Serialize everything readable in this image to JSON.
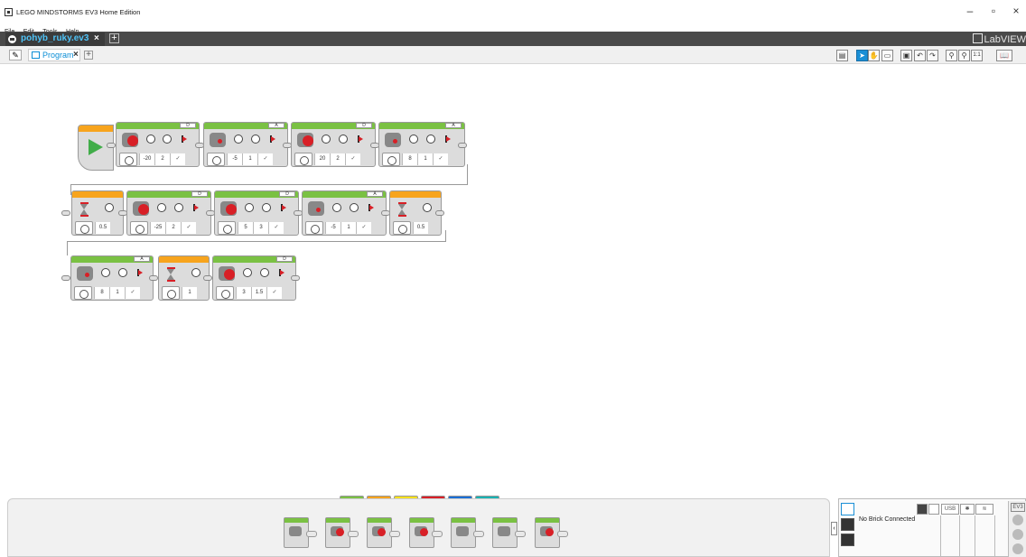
{
  "window": {
    "title": "LEGO MINDSTORMS EV3 Home Edition",
    "minimize": "–",
    "maximize": "▫",
    "close": "×"
  },
  "menu": [
    "File",
    "Edit",
    "Tools",
    "Help"
  ],
  "project": {
    "tab_label": "pohyb_ruky.ev3",
    "close": "×",
    "add": "+",
    "brand": "LabVIEW"
  },
  "program": {
    "tab_label": "Program",
    "close": "×",
    "add": "+"
  },
  "toolbar": {
    "icons": [
      "content-editor-icon",
      "select-icon",
      "pan-icon",
      "comment-icon",
      "save-icon",
      "undo-icon",
      "redo-icon",
      "zoom-in-icon",
      "zoom-out-icon",
      "zoom-reset-icon",
      "content-book-icon"
    ],
    "zoom_reset_label": "1:1"
  },
  "program_blocks": {
    "row1": [
      {
        "kind": "large-motor",
        "port": "D",
        "values": [
          "-20",
          "2",
          "✓"
        ]
      },
      {
        "kind": "medium-motor",
        "port": "A",
        "values": [
          "-5",
          "1",
          "✓"
        ]
      },
      {
        "kind": "large-motor",
        "port": "D",
        "values": [
          "20",
          "2",
          "✓"
        ]
      },
      {
        "kind": "medium-motor",
        "port": "A",
        "values": [
          "8",
          "1",
          "✓"
        ]
      }
    ],
    "row2": [
      {
        "kind": "wait",
        "values": [
          "0.5"
        ]
      },
      {
        "kind": "large-motor",
        "port": "D",
        "values": [
          "-25",
          "2",
          "✓"
        ]
      },
      {
        "kind": "large-motor",
        "port": "D",
        "values": [
          "5",
          "3",
          "✓"
        ]
      },
      {
        "kind": "medium-motor",
        "port": "A",
        "values": [
          "-5",
          "1",
          "✓"
        ]
      },
      {
        "kind": "wait",
        "values": [
          "0.5"
        ]
      }
    ],
    "row3": [
      {
        "kind": "medium-motor",
        "port": "A",
        "values": [
          "8",
          "1",
          "✓"
        ]
      },
      {
        "kind": "wait",
        "values": [
          "1"
        ]
      },
      {
        "kind": "large-motor",
        "port": "D",
        "values": [
          "3",
          "1.5",
          "✓"
        ]
      }
    ]
  },
  "palette": {
    "tab_colors": [
      "#7ac143",
      "#f7a41d",
      "#f7e11d",
      "#d81f26",
      "#1a6fd6",
      "#19b2b2"
    ],
    "blocks": [
      "medium-motor",
      "large-motor",
      "move-steering",
      "move-tank",
      "display",
      "sound",
      "brick-status-light"
    ]
  },
  "hardware": {
    "status": "No Brick Connected",
    "usb": "USB",
    "bluetooth": "✱",
    "wifi": "≋",
    "ev3": "EV3"
  }
}
